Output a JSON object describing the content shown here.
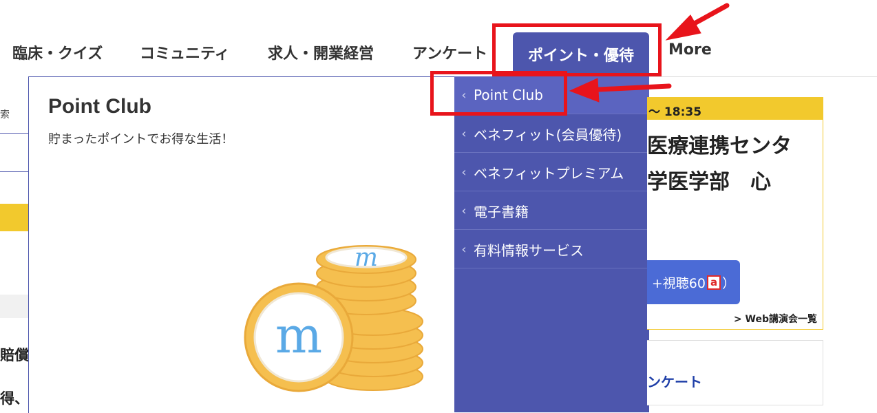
{
  "nav": {
    "items": [
      "臨床・クイズ",
      "コミュニティ",
      "求人・開業経営",
      "アンケート"
    ],
    "active": "ポイント・優待",
    "more": "More"
  },
  "left_strip": {
    "search_fragment": "索",
    "text1": "賠償",
    "text2": "得、E"
  },
  "panel": {
    "title": "Point Club",
    "subtitle": "貯まったポイントでお得な生活！",
    "coin_letter": "m"
  },
  "dropdown": {
    "items": [
      "Point Club",
      "ベネフィット(会員優待)",
      "ベネフィットプレミアム",
      "電子書籍",
      "有料情報サービス"
    ]
  },
  "right_card": {
    "time": "〜 18:35",
    "line1": "医療連携センタ",
    "line2": "学医学部　心",
    "button_prefix": "+視聴60",
    "button_badge": "a",
    "button_suffix": "）",
    "link": "> Web講演会一覧"
  },
  "right_card2": {
    "text": "ンケート"
  },
  "colors": {
    "nav_active": "#4d56ad",
    "highlight_red": "#e8141b",
    "yellow": "#f2c92d",
    "coin_gold": "#f5bf4f"
  }
}
